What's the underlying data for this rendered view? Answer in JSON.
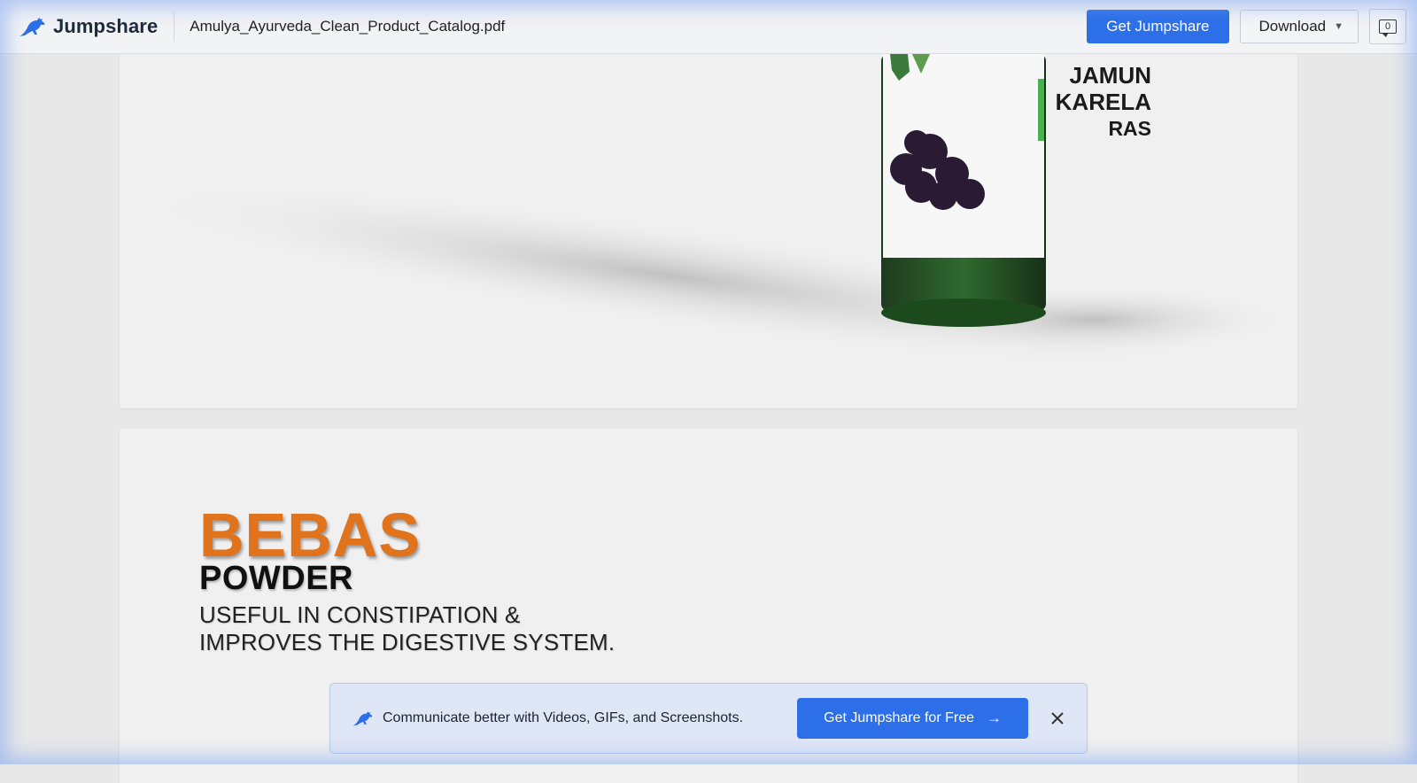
{
  "header": {
    "brand": "Jumpshare",
    "filename": "Amulya_Ayurveda_Clean_Product_Catalog.pdf",
    "get_button": "Get Jumpshare",
    "download_button": "Download",
    "comment_count": "0"
  },
  "page1": {
    "label_line1": "JAMUN",
    "label_line2": "KARELA",
    "label_line3": "RAS"
  },
  "page2": {
    "product_name": "BEBAS",
    "product_type": "POWDER",
    "desc_line1": "USEFUL IN CONSTIPATION &",
    "desc_line2": "IMPROVES THE DIGESTIVE SYSTEM."
  },
  "banner": {
    "text": "Communicate better with Videos, GIFs, and Screenshots.",
    "cta": "Get Jumpshare for Free"
  },
  "colors": {
    "primary": "#2c6fe8",
    "accent_orange": "#e0731c"
  }
}
